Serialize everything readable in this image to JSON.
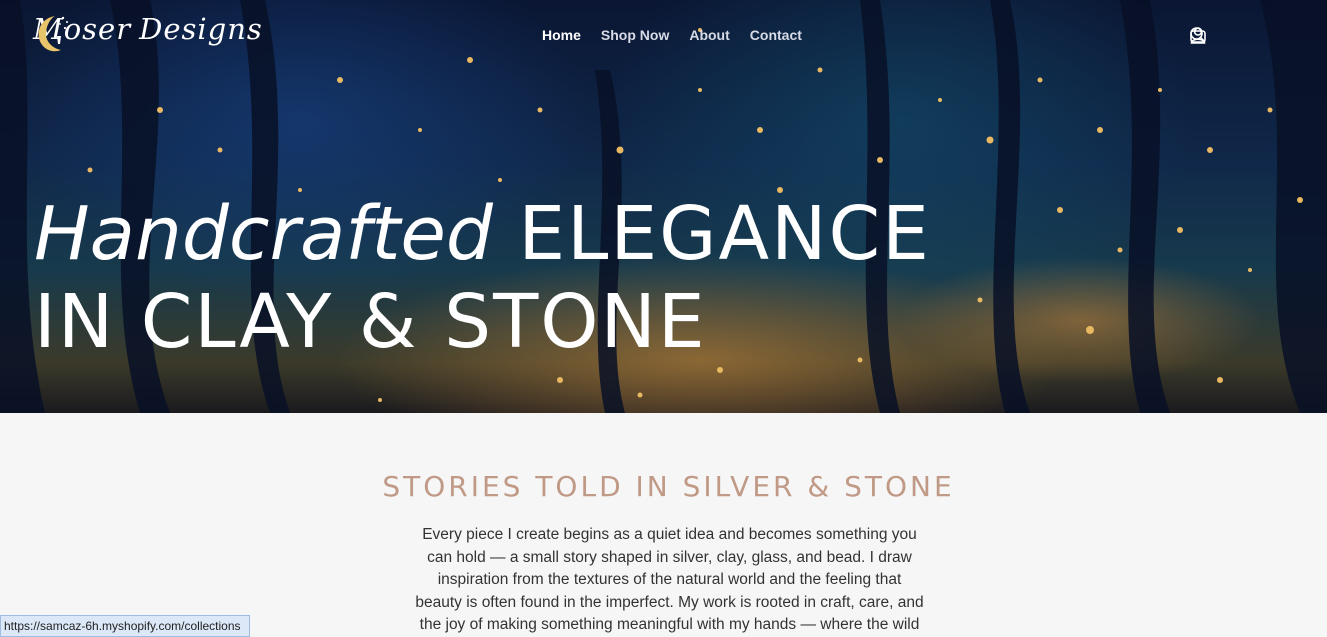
{
  "brand": {
    "left": "Moser",
    "right": "Designs"
  },
  "nav": [
    {
      "label": "Home",
      "active": true
    },
    {
      "label": "Shop Now"
    },
    {
      "label": "About"
    },
    {
      "label": "Contact"
    }
  ],
  "header_icons": [
    "search-icon",
    "account-icon",
    "cart-icon"
  ],
  "hero": {
    "line1_script": "Handcrafted",
    "line1_caps": "ELEGANCE",
    "line2": "IN CLAY & STONE"
  },
  "about": {
    "heading": "STORIES TOLD IN SILVER & STONE",
    "lines": [
      "Every piece I create begins as a quiet idea and becomes something you",
      "can hold — a small story shaped in silver, clay, glass, and bead. I draw",
      "inspiration from the textures of the natural world and the feeling that",
      "beauty is often found in the imperfect. My work is rooted in craft, care, and",
      "the joy of making something meaningful with my hands — where the wild"
    ]
  },
  "status_bar": {
    "url": "https://samcaz-6h.myshopify.com/collections"
  },
  "colors": {
    "heading": "#c09a86",
    "body_text": "#333333",
    "background": "#f6f6f6",
    "status_bg": "#dce8f7"
  }
}
